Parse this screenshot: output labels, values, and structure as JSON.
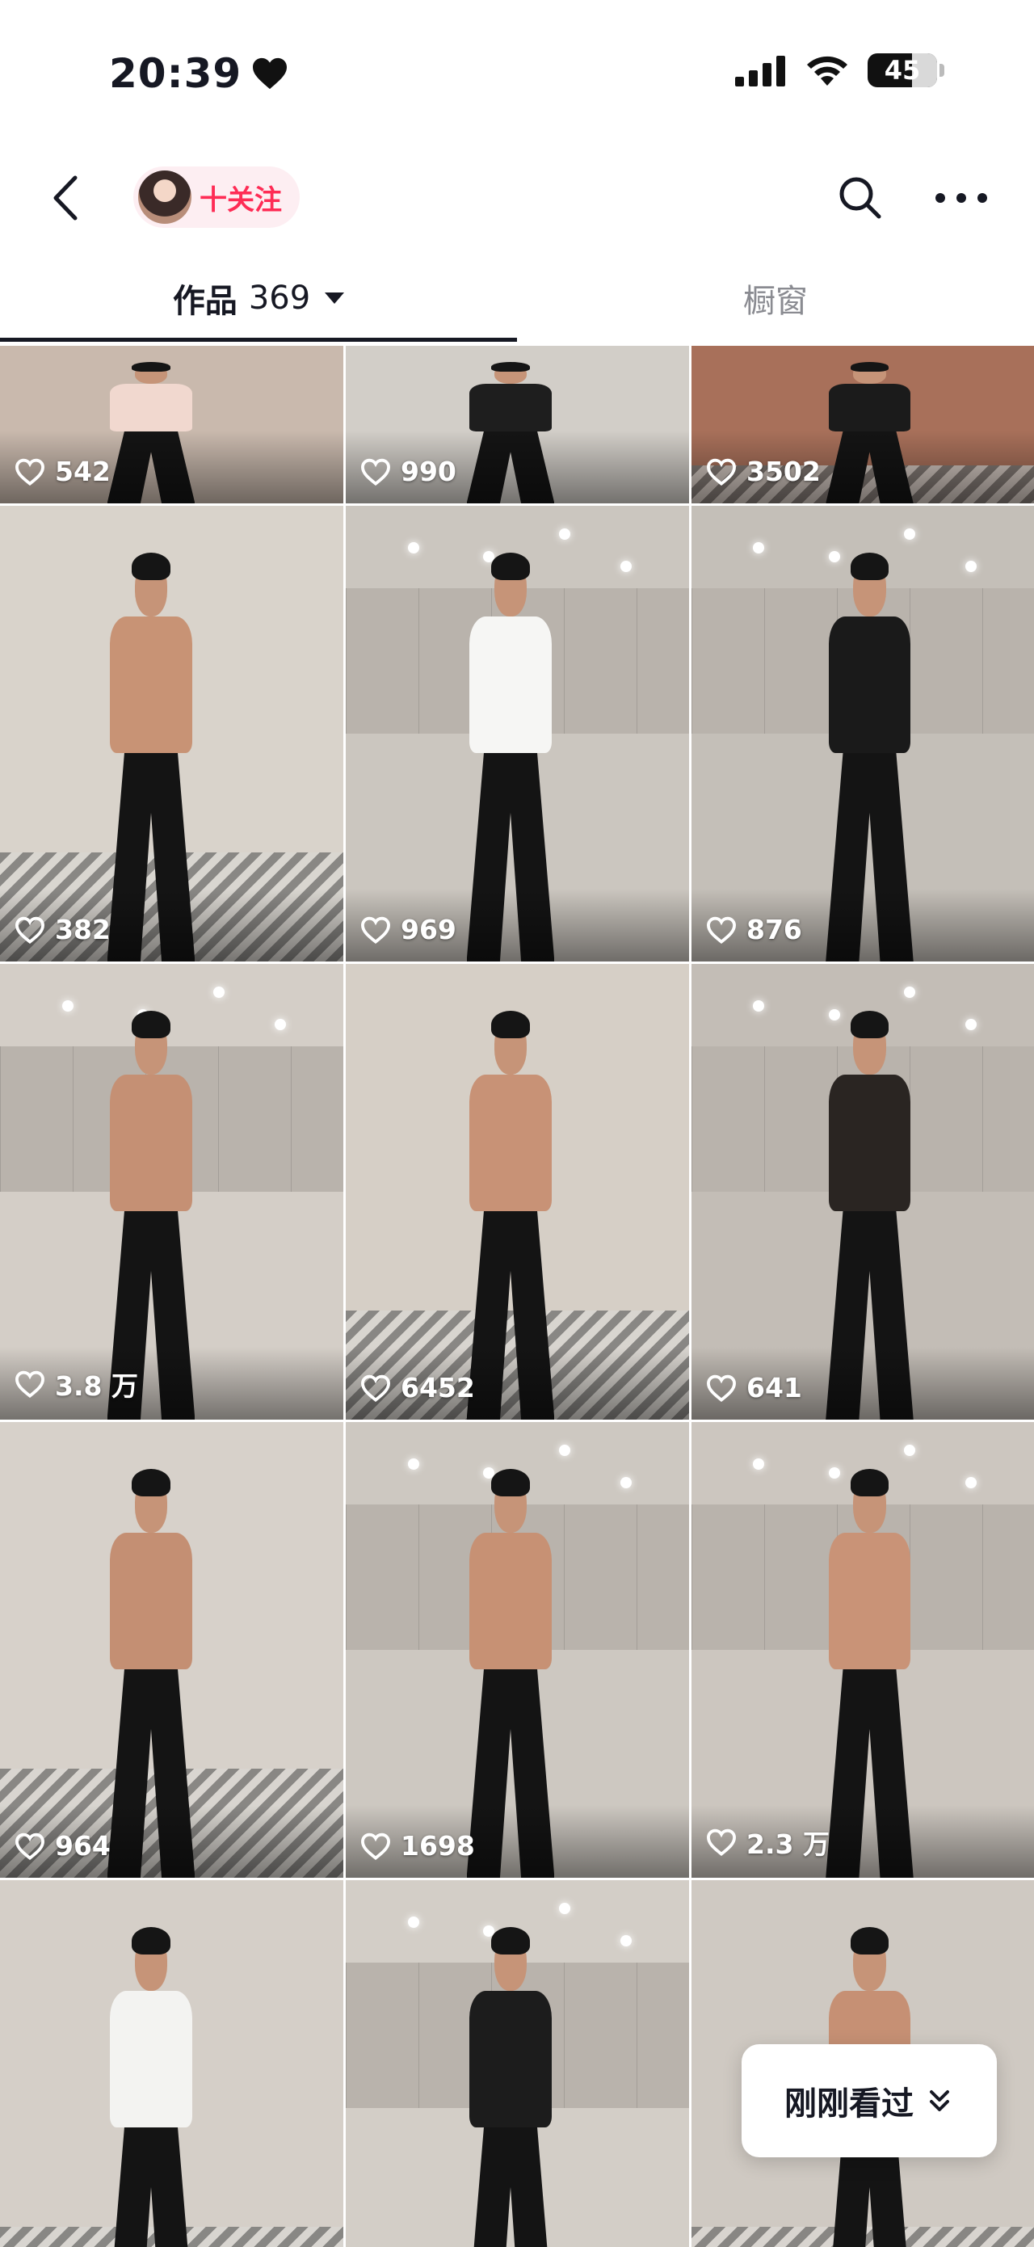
{
  "status_bar": {
    "time": "20:39",
    "battery": "45"
  },
  "profile": {
    "follow_label": "十关注"
  },
  "tabs": {
    "works_label": "作品",
    "works_count": "369",
    "showcase_label": "橱窗"
  },
  "videos": [
    {
      "likes": "542",
      "shirt": "#f1d8cf",
      "bg": "#c9b9ad",
      "shirtless": false,
      "sofa": false,
      "cabinet": false
    },
    {
      "likes": "990",
      "shirt": "#1e1e1e",
      "bg": "#d2cec8",
      "shirtless": false,
      "sofa": false,
      "cabinet": false
    },
    {
      "likes": "3502",
      "shirt": "#1b1b1b",
      "bg": "#a8705a",
      "shirtless": false,
      "sofa": true,
      "cabinet": false
    },
    {
      "likes": "382",
      "shirt": "#c89375",
      "bg": "#d9d3cb",
      "shirtless": true,
      "sofa": true,
      "cabinet": false
    },
    {
      "likes": "969",
      "shirt": "#f6f6f4",
      "bg": "#cbc6bf",
      "shirtless": false,
      "sofa": false,
      "cabinet": true
    },
    {
      "likes": "876",
      "shirt": "#1a1a1a",
      "bg": "#c4bfb8",
      "shirtless": false,
      "sofa": false,
      "cabinet": true
    },
    {
      "likes": "3.8 万",
      "shirt": "#c59074",
      "bg": "#d4cec7",
      "shirtless": true,
      "sofa": false,
      "cabinet": true
    },
    {
      "likes": "6452",
      "shirt": "#c89276",
      "bg": "#d6cfc6",
      "shirtless": true,
      "sofa": true,
      "cabinet": false
    },
    {
      "likes": "641",
      "shirt": "#2a2522",
      "bg": "#c3bdb6",
      "shirtless": false,
      "sofa": false,
      "cabinet": true
    },
    {
      "likes": "964",
      "shirt": "#c48f73",
      "bg": "#d7d1ca",
      "shirtless": true,
      "sofa": true,
      "cabinet": false
    },
    {
      "likes": "1698",
      "shirt": "#c79174",
      "bg": "#cdc8c1",
      "shirtless": true,
      "sofa": false,
      "cabinet": true
    },
    {
      "likes": "2.3 万",
      "shirt": "#c99377",
      "bg": "#ccc6bf",
      "shirtless": true,
      "sofa": false,
      "cabinet": true
    },
    {
      "likes": "",
      "shirt": "#f3f3f1",
      "bg": "#d5cfc8",
      "shirtless": false,
      "sofa": true,
      "cabinet": false
    },
    {
      "likes": "",
      "shirt": "#1c1c1c",
      "bg": "#d3cec7",
      "shirtless": false,
      "sofa": false,
      "cabinet": true
    },
    {
      "likes": "",
      "shirt": "#c69074",
      "bg": "#cfc9c2",
      "shirtless": true,
      "sofa": true,
      "cabinet": false
    }
  ],
  "floating_button": {
    "label": "刚刚看过"
  },
  "colors": {
    "accent": "#fe2c55",
    "text": "#161823",
    "muted": "#8a8b91"
  },
  "icons": [
    "heart-icon",
    "signal-icon",
    "wifi-icon",
    "battery-icon",
    "back-icon",
    "search-icon",
    "more-icon",
    "caret-down-icon",
    "like-heart-icon",
    "double-chevron-down-icon"
  ]
}
